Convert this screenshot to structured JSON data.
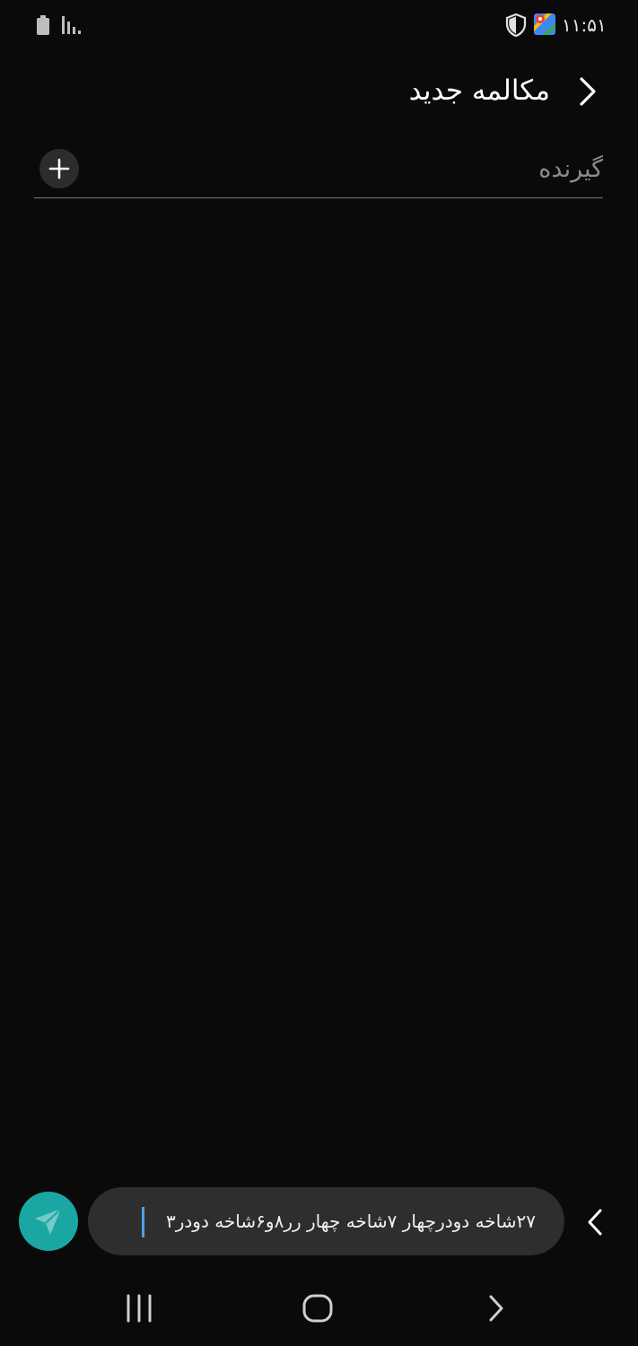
{
  "status_bar": {
    "time": "۱۱:۵۱",
    "icons": [
      "battery-icon",
      "signal-icon",
      "shield-icon",
      "maps-icon"
    ]
  },
  "header": {
    "title": "مکالمه جدید",
    "back_icon": "chevron-right-icon"
  },
  "recipient": {
    "placeholder": "گیرنده",
    "value": "",
    "add_icon": "plus-icon"
  },
  "composer": {
    "message_text": "۲۷شاخه دودرچهار ۷شاخه چهار رر۸و۶شاخه دودر۳",
    "send_icon": "send-icon",
    "expand_icon": "chevron-left-icon"
  },
  "navigation": {
    "icons": [
      "recent-apps-icon",
      "home-icon",
      "back-icon"
    ]
  },
  "colors": {
    "background": "#0a0a0a",
    "send_button": "#1aa7a3",
    "compose_box": "#2e2e2e",
    "cursor": "#4aa3e8"
  }
}
